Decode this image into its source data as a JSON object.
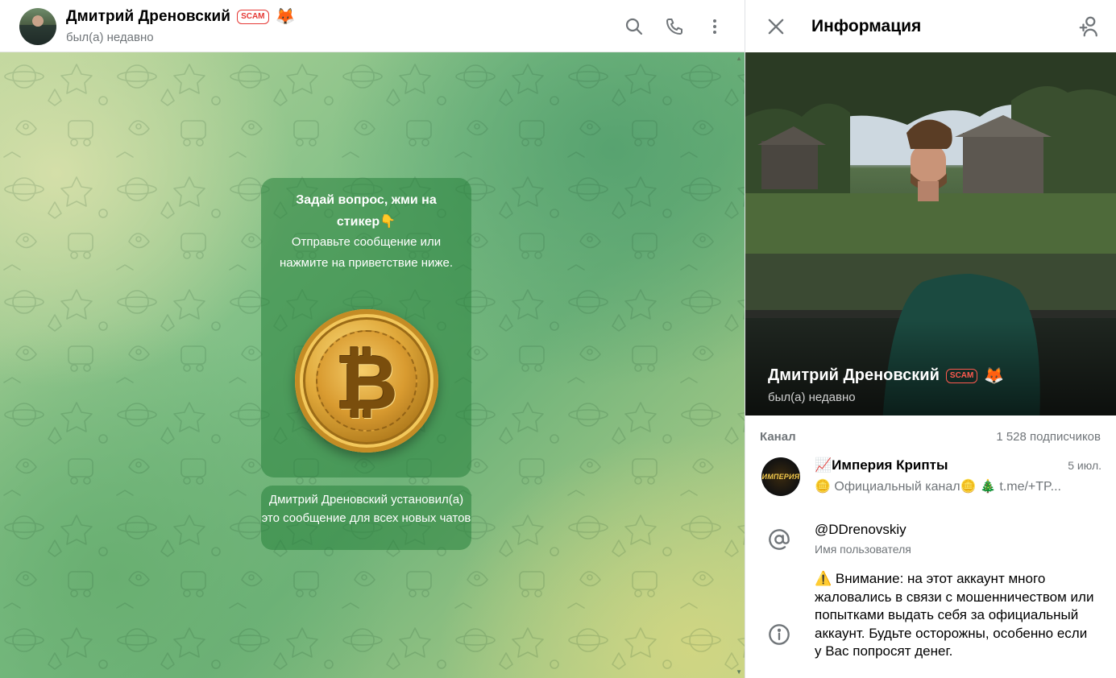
{
  "chat_header": {
    "name": "Дмитрий Дреновский",
    "scam_label": "SCAM",
    "emoji_status": "🦊",
    "status": "был(а) недавно",
    "actions": [
      "search-icon",
      "phone-icon",
      "more-vertical-icon"
    ]
  },
  "chat": {
    "greeting_title": "Задай вопрос, жми на стикер👇",
    "greeting_text": "Отправьте сообщение или нажмите на приветствие ниже.",
    "sticker": "₿",
    "service_message": "Дмитрий Дреновский установил(а) это сообщение для всех новых чатов"
  },
  "info_panel": {
    "title": "Информация",
    "profile_name": "Дмитрий Дреновский",
    "scam_label": "SCAM",
    "emoji_status": "🦊",
    "profile_status": "был(а) недавно",
    "channel_section_label": "Канал",
    "channel_subscribers": "1 528 подписчиков",
    "channel": {
      "name": "📈Империя Крипты",
      "date": "5 июл.",
      "preview": "🪙 Официальный канал🪙 🎄 t.me/+TP...",
      "avatar_text": "ИМПЕРИЯ"
    },
    "username": "@DDrenovskiy",
    "username_caption": "Имя пользователя",
    "bio": "⚠️ Внимание: на этот аккаунт много жаловались в связи с мошенничеством или попытками выдать себя за официальный аккаунт. Будьте осторожны, особенно если у Вас попросят денег."
  },
  "colors": {
    "scam_red": "#e53935",
    "secondary_text": "#707579",
    "bubble_green": "#2e8a45"
  }
}
